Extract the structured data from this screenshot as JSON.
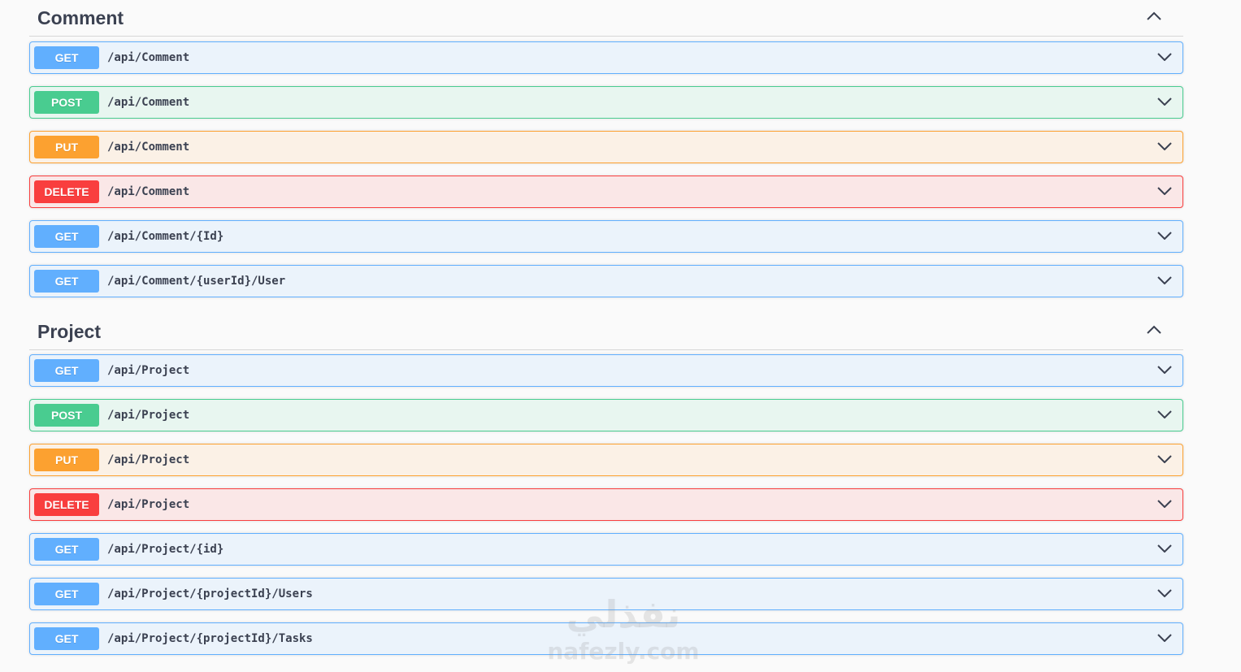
{
  "sections": [
    {
      "title": "Comment",
      "collapse_icon": "chevron-up-icon",
      "operations": [
        {
          "method": "GET",
          "path": "/api/Comment"
        },
        {
          "method": "POST",
          "path": "/api/Comment"
        },
        {
          "method": "PUT",
          "path": "/api/Comment"
        },
        {
          "method": "DELETE",
          "path": "/api/Comment"
        },
        {
          "method": "GET",
          "path": "/api/Comment/{Id}"
        },
        {
          "method": "GET",
          "path": "/api/Comment/{userId}/User"
        }
      ]
    },
    {
      "title": "Project",
      "collapse_icon": "chevron-up-icon",
      "operations": [
        {
          "method": "GET",
          "path": "/api/Project"
        },
        {
          "method": "POST",
          "path": "/api/Project"
        },
        {
          "method": "PUT",
          "path": "/api/Project"
        },
        {
          "method": "DELETE",
          "path": "/api/Project"
        },
        {
          "method": "GET",
          "path": "/api/Project/{id}"
        },
        {
          "method": "GET",
          "path": "/api/Project/{projectId}/Users"
        },
        {
          "method": "GET",
          "path": "/api/Project/{projectId}/Tasks"
        }
      ]
    }
  ],
  "expand_icon": "chevron-down-icon",
  "colors": {
    "get": "#61affe",
    "post": "#49cc90",
    "put": "#fca130",
    "delete": "#f93e3e",
    "title": "#3b4151"
  },
  "watermark": {
    "arabic": "نفذلي",
    "latin": "nafezly.com"
  }
}
